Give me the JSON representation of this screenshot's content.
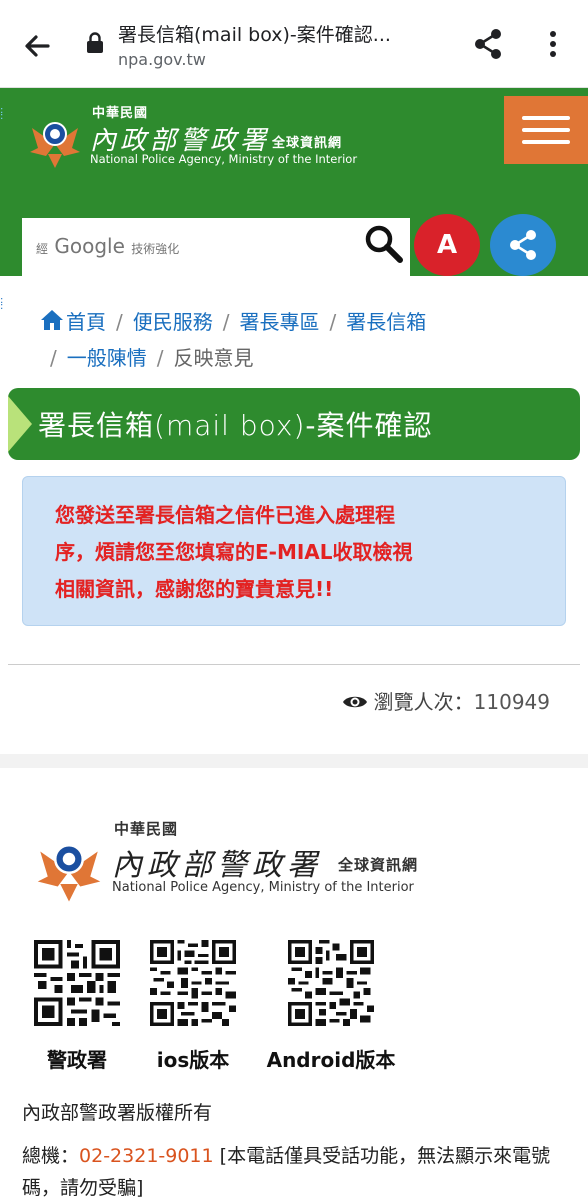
{
  "browser": {
    "title": "署長信箱(mail box)-案件確認...",
    "url": "npa.gov.tw"
  },
  "header": {
    "logo_cn_small": "中華民國",
    "logo_cn_main": "內政部警政署",
    "logo_cn_sub": "全球資訊網",
    "logo_en": "National Police Agency, Ministry of the Interior",
    "search_brand_prefix": "經",
    "search_brand": "Google",
    "search_brand_suffix": "技術強化",
    "font_size_button": "A",
    "colors": {
      "green": "#2e8b2e",
      "orange": "#e07636",
      "red": "#d9222a",
      "blue": "#2b8ad1"
    }
  },
  "breadcrumb": {
    "items": [
      "首頁",
      "便民服務",
      "署長專區",
      "署長信箱",
      "一般陳情"
    ],
    "current": "反映意見"
  },
  "page_heading": {
    "main": "署長信箱",
    "thin": "(mail box)",
    "suffix": "-案件確認"
  },
  "notice": {
    "line1": "您發送至署長信箱之信件已進入處理程",
    "line2": "序，煩請您至您填寫的E-MIAL收取檢視",
    "line3": "相關資訊，感謝您的寶貴意見!!"
  },
  "views": {
    "label": "瀏覽人次：",
    "count": "110949"
  },
  "footer": {
    "logo_cn_small": "中華民國",
    "logo_cn_main": "內政部警政署",
    "logo_cn_sub": "全球資訊網",
    "logo_en": "National Police Agency, Ministry of the Interior",
    "qr_labels": [
      "警政署",
      "ios版本",
      "Android版本"
    ],
    "copyright": "內政部警政署版權所有",
    "phone_label": "總機：",
    "phone_number": "02-2321-9011",
    "phone_note": " [本電話僅具受話功能，無法顯示來電號碼，請勿受騙]"
  }
}
